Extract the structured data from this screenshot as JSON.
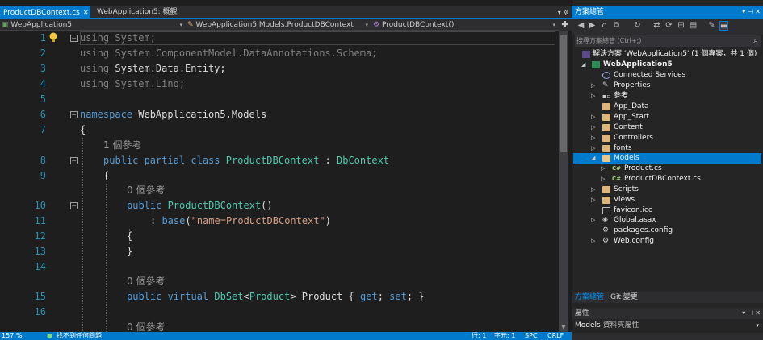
{
  "tabs": [
    {
      "label": "ProductDBContext.cs",
      "close": "✕",
      "active": true
    },
    {
      "label": "WebApplication5: 概觀",
      "active": false
    }
  ],
  "tabbar_right": "▾ ✲",
  "nav": {
    "project": "WebApplication5",
    "class": "WebApplication5.Models.ProductDBContext",
    "member": "ProductDBContext()"
  },
  "editor": {
    "line_numbers": [
      "1",
      "2",
      "3",
      "4",
      "5",
      "6",
      "7",
      "",
      "8",
      "9",
      "",
      "10",
      "11",
      "12",
      "13",
      "14",
      "",
      "15",
      "16",
      ""
    ],
    "code_lens": {
      "r1": "1 個參考",
      "r2": "0 個參考",
      "r3": "0 個參考",
      "r4": "0 個參考"
    },
    "code": {
      "using1_kw": "using",
      "using1_ns": " System;",
      "using2_kw": "using",
      "using2_ns": " System.ComponentModel.DataAnnotations.Schema;",
      "using3_kw": "using",
      "using3_ns": " System.Data.Entity;",
      "using4_kw": "using",
      "using4_ns": " System.Linq;",
      "ns_kw": "namespace",
      "ns_name": " WebApplication5.Models",
      "open1": "{",
      "cls_kw": "public partial class ",
      "cls_name": "ProductDBContext",
      "cls_sep": " : ",
      "cls_base": "DbContext",
      "open2": "{",
      "ctor_kw": "public ",
      "ctor_name": "ProductDBContext",
      "ctor_par": "()",
      "base_pre": ": ",
      "base_kw": "base",
      "base_open": "(",
      "base_str": "\"name=ProductDBContext\"",
      "base_close": ")",
      "open3": "{",
      "close3": "}",
      "prop_kw": "public virtual ",
      "prop_t1": "DbSet",
      "prop_lt": "<",
      "prop_t2": "Product",
      "prop_rest": "> Product { ",
      "prop_get": "get",
      "prop_semi1": "; ",
      "prop_set": "set",
      "prop_end": "; }"
    }
  },
  "status": {
    "zoom": "157 %",
    "issues": "找不到任何問題",
    "line": "行: 1",
    "col": "字元: 1",
    "spc": "SPC",
    "crlf": "CRLF"
  },
  "solution_explorer": {
    "title": "方案總管",
    "search_placeholder": "搜尋方案總管 (Ctrl+;)",
    "toolbar_icons": [
      "back-icon",
      "forward-icon",
      "home-icon",
      "switch-views-icon",
      "history-icon",
      "sync-icon",
      "refresh-icon",
      "collapse-all-icon",
      "show-all-files-icon",
      "properties-icon",
      "preview-icon"
    ],
    "tree": [
      {
        "label": "解決方案 'WebApplication5' (1 個專案，共 1 個)",
        "indent": 0,
        "arrow": "",
        "icon": "solution-icon"
      },
      {
        "label": "WebApplication5",
        "indent": 1,
        "arrow": "◢",
        "icon": "project-icon",
        "bold": true
      },
      {
        "label": "Connected Services",
        "indent": 2,
        "arrow": "",
        "icon": "connected-services-icon"
      },
      {
        "label": "Properties",
        "indent": 2,
        "arrow": "▷",
        "icon": "wrench-icon"
      },
      {
        "label": "參考",
        "indent": 2,
        "arrow": "▷",
        "icon": "references-icon"
      },
      {
        "label": "App_Data",
        "indent": 2,
        "arrow": "",
        "icon": "folder-icon"
      },
      {
        "label": "App_Start",
        "indent": 2,
        "arrow": "▷",
        "icon": "folder-icon"
      },
      {
        "label": "Content",
        "indent": 2,
        "arrow": "▷",
        "icon": "folder-icon"
      },
      {
        "label": "Controllers",
        "indent": 2,
        "arrow": "▷",
        "icon": "folder-icon"
      },
      {
        "label": "fonts",
        "indent": 2,
        "arrow": "▷",
        "icon": "folder-icon"
      },
      {
        "label": "Models",
        "indent": 2,
        "arrow": "◢",
        "icon": "folder-open-icon",
        "selected": true
      },
      {
        "label": "Product.cs",
        "indent": 3,
        "arrow": "▷",
        "icon": "csharp-file-icon"
      },
      {
        "label": "ProductDBContext.cs",
        "indent": 3,
        "arrow": "▷",
        "icon": "csharp-file-icon"
      },
      {
        "label": "Scripts",
        "indent": 2,
        "arrow": "▷",
        "icon": "folder-icon"
      },
      {
        "label": "Views",
        "indent": 2,
        "arrow": "▷",
        "icon": "folder-icon"
      },
      {
        "label": "favicon.ico",
        "indent": 2,
        "arrow": "",
        "icon": "image-file-icon"
      },
      {
        "label": "Global.asax",
        "indent": 2,
        "arrow": "▷",
        "icon": "global-asax-icon"
      },
      {
        "label": "packages.config",
        "indent": 2,
        "arrow": "",
        "icon": "config-file-icon"
      },
      {
        "label": "Web.config",
        "indent": 2,
        "arrow": "▷",
        "icon": "config-file-icon"
      }
    ],
    "bottom_tabs": [
      "方案總管",
      "Git 變更"
    ]
  },
  "properties": {
    "title": "屬性",
    "object": "Models",
    "object_type": "資料夾屬性"
  },
  "colors": {
    "accent": "#007acc",
    "keyword": "#569cd6",
    "type": "#4ec9b0",
    "string": "#d69d85",
    "line_number": "#2b91af"
  }
}
